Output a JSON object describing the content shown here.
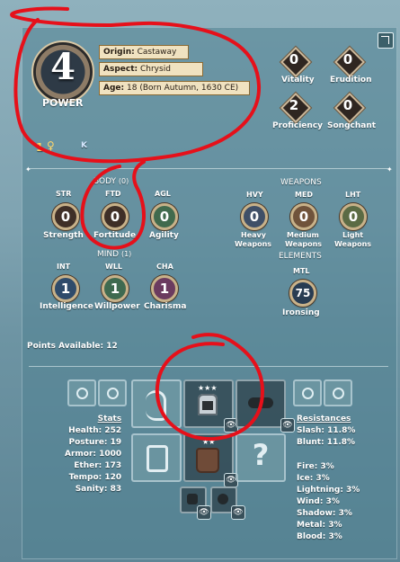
{
  "power": {
    "value": "4",
    "label": "POWER"
  },
  "character": {
    "origin_label": "Origin:",
    "origin_value": "Castaway",
    "aspect_label": "Aspect:",
    "aspect_value": "Chrysid",
    "age_label": "Age:",
    "age_value": "18 (Born Autumn, 1630 CE)"
  },
  "top_stats": [
    {
      "value": "0",
      "label": "Vitality"
    },
    {
      "value": "0",
      "label": "Erudition"
    },
    {
      "value": "2",
      "label": "Proficiency"
    },
    {
      "value": "0",
      "label": "Songchant"
    }
  ],
  "currency": {
    "amount": "1",
    "glyph": "♀",
    "rhs": "K"
  },
  "body": {
    "title": "BODY",
    "count": "(0)",
    "stats": [
      {
        "abbr": "STR",
        "value": "0",
        "label": "Strength"
      },
      {
        "abbr": "FTD",
        "value": "0",
        "label": "Fortitude"
      },
      {
        "abbr": "AGL",
        "value": "0",
        "label": "Agility"
      }
    ]
  },
  "mind": {
    "title": "MIND",
    "count": "(1)",
    "stats": [
      {
        "abbr": "INT",
        "value": "1",
        "label": "Intelligence"
      },
      {
        "abbr": "WLL",
        "value": "1",
        "label": "Willpower"
      },
      {
        "abbr": "CHA",
        "value": "1",
        "label": "Charisma"
      }
    ]
  },
  "weapons": {
    "title": "WEAPONS",
    "stats": [
      {
        "abbr": "HVY",
        "value": "0",
        "label1": "Heavy",
        "label2": "Weapons"
      },
      {
        "abbr": "MED",
        "value": "0",
        "label1": "Medium",
        "label2": "Weapons"
      },
      {
        "abbr": "LHT",
        "value": "0",
        "label1": "Light",
        "label2": "Weapons"
      }
    ]
  },
  "elements": {
    "title": "ELEMENTS",
    "stats": [
      {
        "abbr": "MTL",
        "value": "75",
        "label": "Ironsing"
      }
    ]
  },
  "points_available": {
    "label": "Points Available:",
    "value": "12"
  },
  "stats_panel": {
    "title": "Stats",
    "rows": [
      "Health: 252",
      "Posture: 19",
      "Armor: 1000",
      "Ether: 173",
      "Tempo: 120",
      "Sanity: 83"
    ]
  },
  "resistances": {
    "title": "Resistances",
    "rows1": [
      "Slash: 11.8%",
      "Blunt: 11.8%"
    ],
    "rows2": [
      "Fire: 3%",
      "Ice: 3%",
      "Lightning: 3%",
      "Wind: 3%",
      "Shadow: 3%",
      "Metal: 3%",
      "Blood: 3%"
    ]
  },
  "icons": {
    "expand": "expand-icon",
    "eye": "eye-icon",
    "helmet": "helmet-icon",
    "chest": "chest-armor-icon",
    "gloves": "gloves-icon",
    "ear": "ear-icon",
    "goggles": "goggles-icon",
    "ring": "ring-icon",
    "beard": "beard-icon"
  },
  "colors": {
    "annotation": "#e6101a",
    "medallion_gold": "#c8b28a"
  }
}
